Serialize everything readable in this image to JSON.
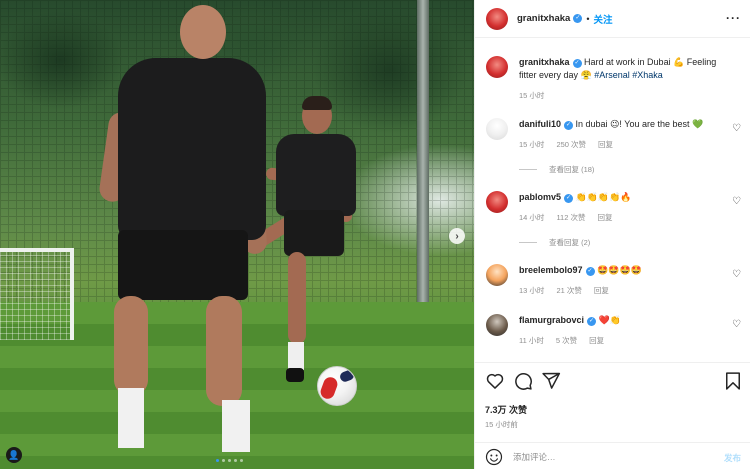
{
  "post": {
    "username": "granitxhaka",
    "follow_label": "关注",
    "dot": "•",
    "more": "···",
    "caption_pre": " Hard at work in Dubai 💪 Feeling fitter every day 😤 ",
    "caption_tag1": "#Arsenal",
    "caption_tag2": "#Xhaka",
    "caption_time": "15 小时"
  },
  "comments": [
    {
      "user": "danifuli10",
      "text": " In dubai 😉! You are the best 💚",
      "time": "15 小时",
      "likes": "250 次赞",
      "reply": "回复",
      "view_replies": "查看回复 (18)"
    },
    {
      "user": "pablomv5",
      "text": " 👏👏👏👏🔥",
      "time": "14 小时",
      "likes": "112 次赞",
      "reply": "回复",
      "view_replies": "查看回复 (2)"
    },
    {
      "user": "breelembolo97",
      "text": " 🤩🤩🤩🤩",
      "time": "13 小时",
      "likes": "21 次赞",
      "reply": "回复"
    },
    {
      "user": "flamurgrabovci",
      "text": " ❤️👏",
      "time": "11 小时",
      "likes": "5 次赞",
      "reply": "回复"
    }
  ],
  "footer": {
    "likes": "7.3万 次赞",
    "time": "15 小时前",
    "comment_placeholder": "添加评论…",
    "post_label": "发布"
  },
  "icons": {
    "verified": "✓",
    "heart": "♡",
    "next": "›",
    "user_tag": "👤"
  },
  "colors": {
    "accent": "#0095f6",
    "post_disabled": "#b2dffc",
    "hashtag": "#00376b",
    "verified": "#3897f0"
  }
}
